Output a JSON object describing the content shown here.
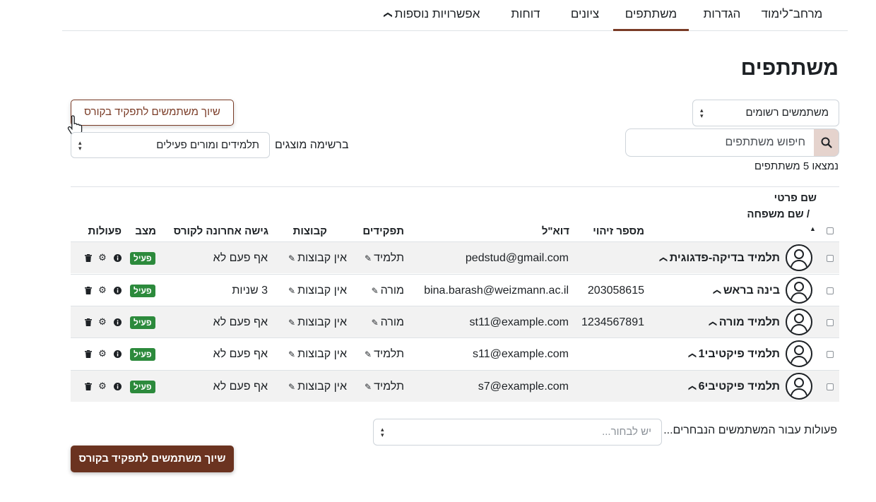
{
  "nav": {
    "tabs": [
      {
        "label": "מרחב־לימוד",
        "active": false
      },
      {
        "label": "הגדרות",
        "active": false
      },
      {
        "label": "משתתפים",
        "active": true
      },
      {
        "label": "ציונים",
        "active": false
      },
      {
        "label": "דוחות",
        "active": false
      },
      {
        "label": "אפשרויות נוספות",
        "active": false,
        "dropdown": true
      }
    ]
  },
  "page": {
    "title": "משתתפים"
  },
  "controls": {
    "user_select": "משתמשים רשומים",
    "search_placeholder": "חיפוש משתתפים",
    "found_count": "נמצאו 5 משתתפים",
    "enrol_button": "שיוך משתמשים לתפקיד בקורס",
    "filter_label": "ברשימה מוצגים",
    "filter_value": "תלמידים ומורים פעילים"
  },
  "table": {
    "headers": {
      "name_line1": "שם פרטי",
      "name_line2": "/ שם משפחה",
      "id": "מספר זיהוי",
      "email": "דוא\"ל",
      "roles": "תפקידים",
      "groups": "קבוצות",
      "last_access": "גישה אחרונה לקורס",
      "status": "מצב",
      "actions": "פעולות"
    },
    "rows": [
      {
        "name": "תלמיד בדיקה-פדגוגית",
        "id": "",
        "email": "pedstud@gmail.com",
        "role": "תלמיד",
        "groups": "אין קבוצות",
        "last_access": "אף פעם לא",
        "status": "פעיל"
      },
      {
        "name": "בינה בראש",
        "id": "203058615",
        "email": "bina.barash@weizmann.ac.il",
        "role": "מורה",
        "groups": "אין קבוצות",
        "last_access": "3 שניות",
        "status": "פעיל"
      },
      {
        "name": "תלמיד מורה",
        "id": "1234567891",
        "email": "st11@example.com",
        "role": "מורה",
        "groups": "אין קבוצות",
        "last_access": "אף פעם לא",
        "status": "פעיל"
      },
      {
        "name": "תלמיד פיקטיבי1",
        "id": "",
        "email": "s11@example.com",
        "role": "תלמיד",
        "groups": "אין קבוצות",
        "last_access": "אף פעם לא",
        "status": "פעיל"
      },
      {
        "name": "תלמיד פיקטיבי6",
        "id": "",
        "email": "s7@example.com",
        "role": "תלמיד",
        "groups": "אין קבוצות",
        "last_access": "אף פעם לא",
        "status": "פעיל"
      }
    ]
  },
  "bulk": {
    "label": "פעולות עבור המשתמשים הנבחרים...",
    "placeholder": "יש לבחור..."
  },
  "colors": {
    "brand": "#7a3b26",
    "brand_dark": "#6b3320",
    "status_active": "#2c8a3c"
  }
}
